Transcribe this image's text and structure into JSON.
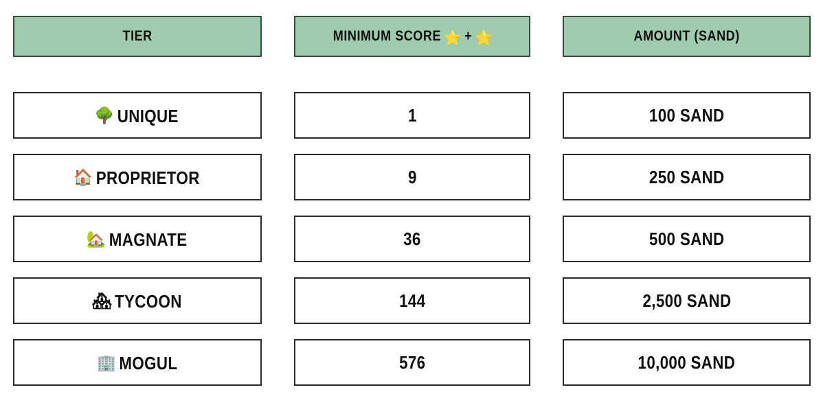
{
  "table": {
    "columns": [
      {
        "key": "tier",
        "label": "TIER"
      },
      {
        "key": "score",
        "label": "MINIMUM SCORE",
        "emoji_suffix": "⭐ + 🌟",
        "emoji_a": "⭐",
        "emoji_plus": "+",
        "emoji_b": "🌟"
      },
      {
        "key": "amount",
        "label": "AMOUNT (SAND)"
      }
    ],
    "header_background": "#9fcbaf",
    "border_color": "#2b2b2b",
    "rows": [
      {
        "tier_emoji": "🌳",
        "tier_icon_name": "deciduous-tree-emoji",
        "tier": "UNIQUE",
        "score": "1",
        "amount": "100 SAND"
      },
      {
        "tier_emoji": "🏠",
        "tier_icon_name": "house-emoji",
        "tier": "PROPRIETOR",
        "score": "9",
        "amount": "250 SAND"
      },
      {
        "tier_emoji": "🏡",
        "tier_icon_name": "house-with-garden-emoji",
        "tier": "MAGNATE",
        "score": "36",
        "amount": "500 SAND"
      },
      {
        "tier_emoji": "🏘",
        "tier_icon_name": "houses-emoji",
        "tier": "TYCOON",
        "score": "144",
        "amount": "2,500 SAND"
      },
      {
        "tier_emoji": "🏢",
        "tier_icon_name": "office-building-emoji",
        "tier": "MOGUL",
        "score": "576",
        "amount": "10,000 SAND"
      }
    ]
  }
}
